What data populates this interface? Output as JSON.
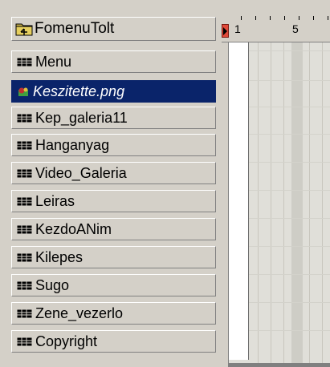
{
  "layers": {
    "header": {
      "label": "FomenuTolt",
      "icon": "folder-icon"
    },
    "items": [
      {
        "label": "Menu",
        "icon": "layer-icon",
        "selected": false
      },
      {
        "label": "Keszitette.png",
        "icon": "bitmap-icon",
        "selected": true
      },
      {
        "label": "Kep_galeria11",
        "icon": "layer-icon",
        "selected": false
      },
      {
        "label": "Hanganyag",
        "icon": "layer-icon",
        "selected": false
      },
      {
        "label": "Video_Galeria",
        "icon": "layer-icon",
        "selected": false
      },
      {
        "label": "Leiras",
        "icon": "layer-icon",
        "selected": false
      },
      {
        "label": "KezdoANim",
        "icon": "layer-icon",
        "selected": false
      },
      {
        "label": "Kilepes",
        "icon": "layer-icon",
        "selected": false
      },
      {
        "label": "Sugo",
        "icon": "layer-icon",
        "selected": false
      },
      {
        "label": "Zene_vezerlo",
        "icon": "layer-icon",
        "selected": false
      },
      {
        "label": "Copyright",
        "icon": "layer-icon",
        "selected": false
      }
    ]
  },
  "timeline": {
    "ruler_labels": [
      "1",
      "5"
    ],
    "playhead_color": "#e04a3a"
  },
  "colors": {
    "selection": "#0a246a",
    "panel": "#d4d0c8"
  }
}
